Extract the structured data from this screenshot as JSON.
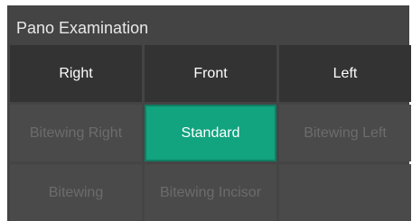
{
  "panel": {
    "title": "Pano Examination"
  },
  "buttons": {
    "right": "Right",
    "front": "Front",
    "left": "Left",
    "bitewing_right": "Bitewing Right",
    "standard": "Standard",
    "bitewing_left": "Bitewing Left",
    "bitewing": "Bitewing",
    "bitewing_incisor": "Bitewing Incisor"
  },
  "colors": {
    "panel_bg": "#444444",
    "active_button_bg": "#333333",
    "disabled_button_bg": "#4a4a4a",
    "selected_button_bg": "#12a37f",
    "disabled_text": "#6c6c6c"
  }
}
